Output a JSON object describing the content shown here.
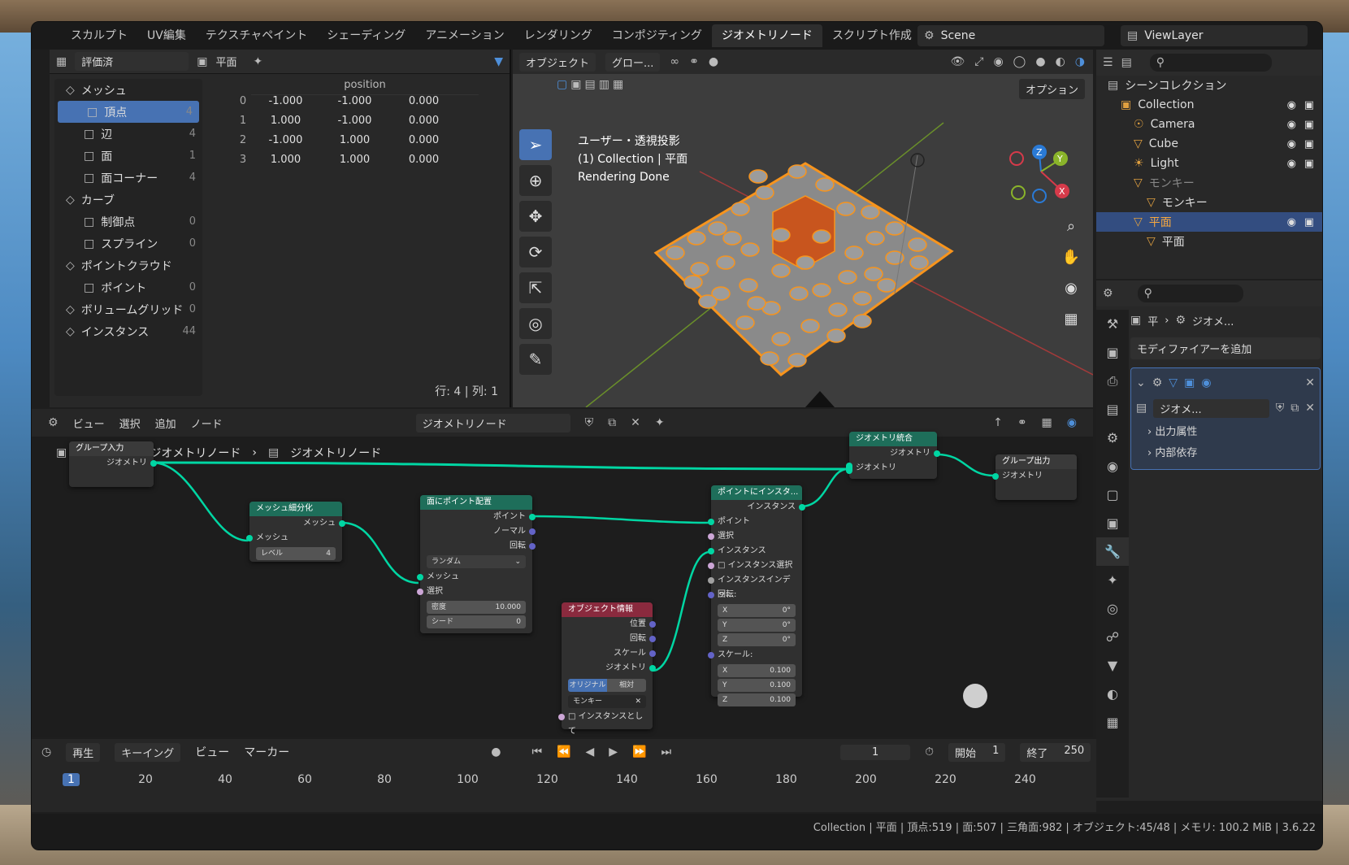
{
  "workspaces": [
    "スカルプト",
    "UV編集",
    "テクスチャペイント",
    "シェーディング",
    "アニメーション",
    "レンダリング",
    "コンポジティング",
    "ジオメトリノード",
    "スクリプト作成"
  ],
  "active_workspace": "ジオメトリノード",
  "scene": "Scene",
  "view_layer": "ViewLayer",
  "spreadsheet": {
    "mode": "評価済",
    "object": "平面",
    "column": "position",
    "domains": [
      {
        "label": "メッシュ",
        "count": ""
      },
      {
        "label": "頂点",
        "count": "4"
      },
      {
        "label": "辺",
        "count": "4"
      },
      {
        "label": "面",
        "count": "1"
      },
      {
        "label": "面コーナー",
        "count": "4"
      },
      {
        "label": "カーブ",
        "count": ""
      },
      {
        "label": "制御点",
        "count": "0"
      },
      {
        "label": "スプライン",
        "count": "0"
      },
      {
        "label": "ポイントクラウド",
        "count": ""
      },
      {
        "label": "ポイント",
        "count": "0"
      },
      {
        "label": "ボリュームグリッド",
        "count": "0"
      },
      {
        "label": "インスタンス",
        "count": "44"
      }
    ],
    "rows": [
      {
        "i": "0",
        "x": "-1.000",
        "y": "-1.000",
        "z": "0.000"
      },
      {
        "i": "1",
        "x": "1.000",
        "y": "-1.000",
        "z": "0.000"
      },
      {
        "i": "2",
        "x": "-1.000",
        "y": "1.000",
        "z": "0.000"
      },
      {
        "i": "3",
        "x": "1.000",
        "y": "1.000",
        "z": "0.000"
      }
    ],
    "footer": "行: 4 | 列: 1"
  },
  "viewport": {
    "mode": "オブジェクト",
    "transform": "グロー...",
    "info1": "ユーザー・透視投影",
    "info2": "(1) Collection | 平面",
    "info3": "Rendering Done",
    "options": "オプション"
  },
  "outliner": {
    "scene_collection": "シーンコレクション",
    "items": [
      {
        "label": "Collection",
        "indent": 1
      },
      {
        "label": "Camera",
        "indent": 2
      },
      {
        "label": "Cube",
        "indent": 2
      },
      {
        "label": "Light",
        "indent": 2
      },
      {
        "label": "モンキー",
        "indent": 2
      },
      {
        "label": "モンキー",
        "indent": 3
      },
      {
        "label": "平面",
        "indent": 2
      },
      {
        "label": "平面",
        "indent": 3
      }
    ]
  },
  "properties": {
    "breadcrumb1": "平",
    "breadcrumb2": "ジオメ...",
    "add_modifier": "モディファイアーを追加",
    "mod_name": "ジオメ...",
    "section1": "出力属性",
    "section2": "内部依存"
  },
  "node_editor": {
    "menus": [
      "ビュー",
      "選択",
      "追加",
      "ノード"
    ],
    "tree_name": "ジオメトリノード",
    "crumb_obj": "平面",
    "crumb_mod": "ジオメトリノード",
    "crumb_tree": "ジオメトリノード",
    "nodes": {
      "group_input": {
        "title": "グループ入力",
        "out": "ジオメトリ"
      },
      "subdivide": {
        "title": "メッシュ細分化",
        "out": "メッシュ",
        "in": "メッシュ",
        "level_label": "レベル",
        "level": "4"
      },
      "distribute": {
        "title": "面にポイント配置",
        "out1": "ポイント",
        "out2": "ノーマル",
        "out3": "回転",
        "mode": "ランダム",
        "in1": "メッシュ",
        "in2": "選択",
        "density_label": "密度",
        "density": "10.000",
        "seed_label": "シード",
        "seed": "0"
      },
      "object_info": {
        "title": "オブジェクト情報",
        "o1": "位置",
        "o2": "回転",
        "o3": "スケール",
        "o4": "ジオメトリ",
        "tab1": "オリジナル",
        "tab2": "相対",
        "obj": "モンキー",
        "as_inst": "インスタンスとして"
      },
      "instance": {
        "title": "ポイントにインスタ...",
        "out": "インスタンス",
        "i1": "ポイント",
        "i2": "選択",
        "i3": "インスタンス",
        "i4": "インスタンス選択",
        "i5": "インスタンスインデッ...",
        "rot": "回転:",
        "rx": "0°",
        "ry": "0°",
        "rz": "0°",
        "scale": "スケール:",
        "sx": "0.100",
        "sy": "0.100",
        "sz": "0.100"
      },
      "join": {
        "title": "ジオメトリ統合",
        "out": "ジオメトリ",
        "in": "ジオメトリ"
      },
      "group_output": {
        "title": "グループ出力",
        "in": "ジオメトリ"
      }
    }
  },
  "timeline": {
    "play": "再生",
    "keying": "キーイング",
    "view": "ビュー",
    "marker": "マーカー",
    "current": "1",
    "start_label": "開始",
    "start": "1",
    "end_label": "終了",
    "end": "250",
    "ticks": [
      "1",
      "20",
      "40",
      "60",
      "80",
      "100",
      "120",
      "140",
      "160",
      "180",
      "200",
      "220",
      "240"
    ]
  },
  "status": "Collection | 平面 | 頂点:519 | 面:507 | 三角面:982 | オブジェクト:45/48 | メモリ: 100.2 MiB | 3.6.22",
  "colors": {
    "accent": "#4772b3",
    "geo_node": "#1e6e5a",
    "input_node": "#8a2a3e",
    "link": "#00d6a3",
    "selected_outline": "#f7941d"
  }
}
